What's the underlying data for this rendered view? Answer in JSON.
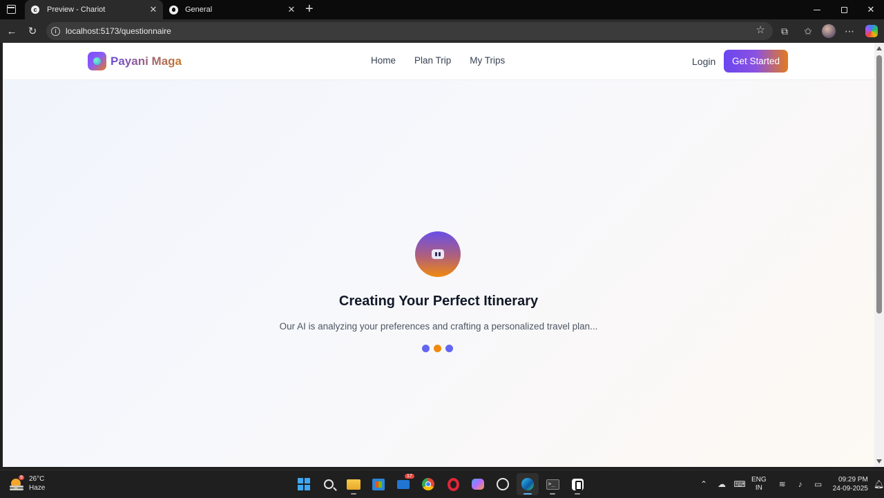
{
  "browser": {
    "tabs": [
      {
        "title": "Preview - Chariot",
        "favicon": "chariot-c-icon",
        "active": true
      },
      {
        "title": "General",
        "favicon": "github-icon",
        "active": false
      }
    ],
    "address": "localhost:5173/questionnaire"
  },
  "site": {
    "brand": "Payani Maga",
    "nav": [
      "Home",
      "Plan Trip",
      "My Trips"
    ],
    "login": "Login",
    "cta": "Get Started"
  },
  "loader": {
    "title": "Creating Your Perfect Itinerary",
    "subtitle": "Our AI is analyzing your preferences and crafting a personalized travel plan...",
    "dot_colors": [
      "#6366f1",
      "#f08a0f",
      "#6366f1"
    ]
  },
  "taskbar": {
    "weather": {
      "temp": "26°C",
      "condition": "Haze",
      "badge": "9"
    },
    "mail_badge": "17",
    "language": {
      "line1": "ENG",
      "line2": "IN"
    },
    "clock": {
      "time": "09:29 PM",
      "date": "24-09-2025"
    }
  },
  "colors": {
    "accent_purple": "#6b46f0",
    "accent_orange": "#e37b1f"
  }
}
